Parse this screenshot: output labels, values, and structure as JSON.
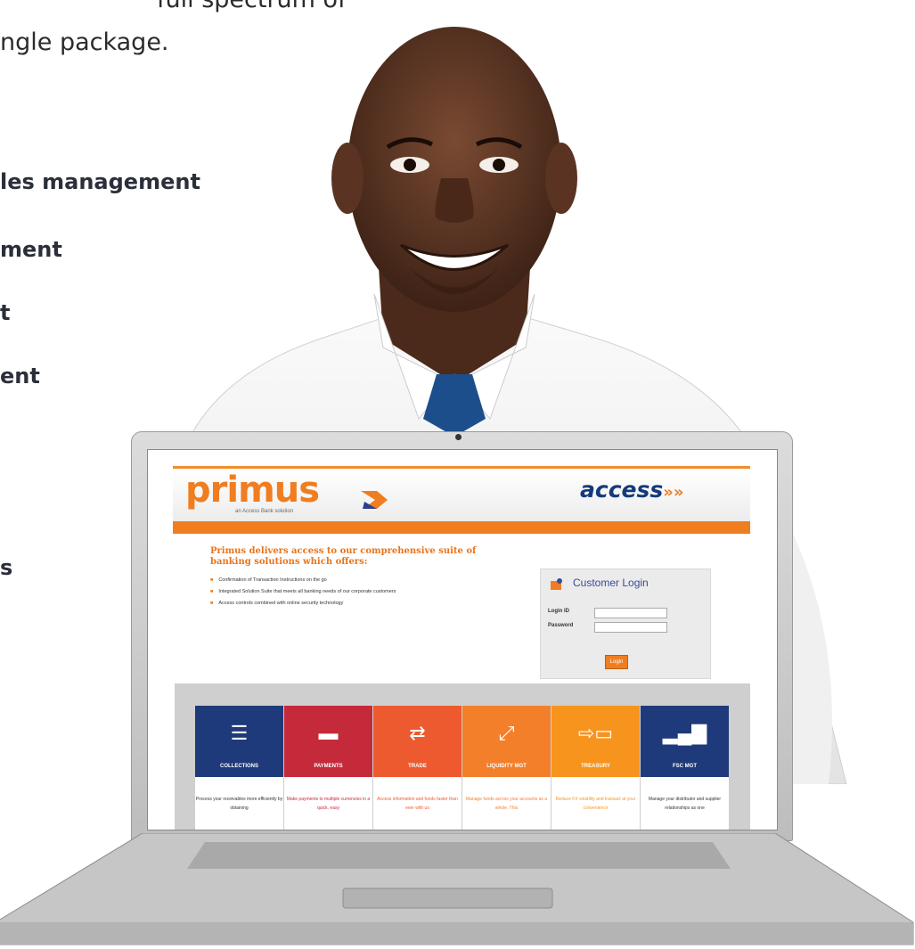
{
  "intro": {
    "line1": "full spectrum of",
    "line2": "ngle package."
  },
  "bullets": [
    "les management",
    "ment",
    "t",
    "ent",
    "s"
  ],
  "portal": {
    "logo_text": "primus",
    "logo_sub": "an Access Bank solution",
    "bank_logo": "access",
    "bank_logo_arrows": "»»",
    "headline": "Primus delivers access to our comprehensive suite of banking solutions which offers:",
    "features": [
      "Confirmation of Transaction Instructions on the go",
      "Integrated Solution Suite that meets all banking needs of our corporate customers",
      "Access controls combined with online security technology"
    ],
    "login": {
      "title": "Customer Login",
      "login_id_label": "Login ID",
      "password_label": "Password",
      "button": "Login"
    },
    "tiles": [
      {
        "label": "COLLECTIONS",
        "icon": "list-icon",
        "color": "#1f3a7a",
        "desc": "Process your receivables more efficiently by obtaining"
      },
      {
        "label": "PAYMENTS",
        "icon": "folder-lock-icon",
        "color": "#c42a3a",
        "desc": "Make payments to multiple currencies in a quick, easy"
      },
      {
        "label": "TRADE",
        "icon": "exchange-icon",
        "color": "#ee5a2f",
        "desc": "Access information and funds faster than ever with us"
      },
      {
        "label": "LIQUIDITY MGT",
        "icon": "expand-icon",
        "color": "#f47f2a",
        "desc": "Manage funds across your accounts as a whole. This"
      },
      {
        "label": "TREASURY",
        "icon": "transfer-box-icon",
        "color": "#f7941e",
        "desc": "Reduce FX volatility and transact at your convenience"
      },
      {
        "label": "FSC MGT",
        "icon": "bar-chart-icon",
        "color": "#1f3a7a",
        "desc": "Manage your distributor and supplier relationships as one"
      }
    ]
  },
  "colors": {
    "accent_orange": "#f07d1f",
    "navy": "#143a7b"
  }
}
